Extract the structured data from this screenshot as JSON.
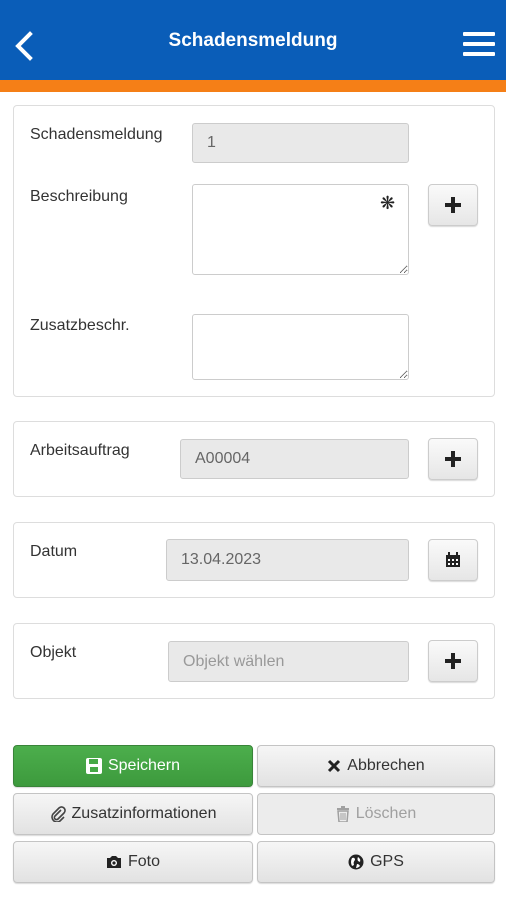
{
  "header": {
    "title": "Schadensmeldung",
    "back_icon": "chevron-left-icon",
    "menu_icon": "hamburger-menu-icon",
    "color": "#0a5db8",
    "stripe_color": "#f57f17"
  },
  "form": {
    "schadensmeldung": {
      "label": "Schadensmeldung",
      "value": "1"
    },
    "beschreibung": {
      "label": "Beschreibung",
      "value": "",
      "required_marker": "❋"
    },
    "zusatzbeschr": {
      "label": "Zusatzbeschr.",
      "value": ""
    },
    "arbeitsauftrag": {
      "label": "Arbeitsauftrag",
      "value": "A00004"
    },
    "datum": {
      "label": "Datum",
      "value": "13.04.2023"
    },
    "objekt": {
      "label": "Objekt",
      "placeholder": "Objekt wählen"
    }
  },
  "buttons": {
    "save": "Speichern",
    "cancel": "Abbrechen",
    "additional_info": "Zusatzinformationen",
    "delete": "Löschen",
    "photo": "Foto",
    "gps": "GPS"
  },
  "colors": {
    "primary_green": "#46a946"
  }
}
